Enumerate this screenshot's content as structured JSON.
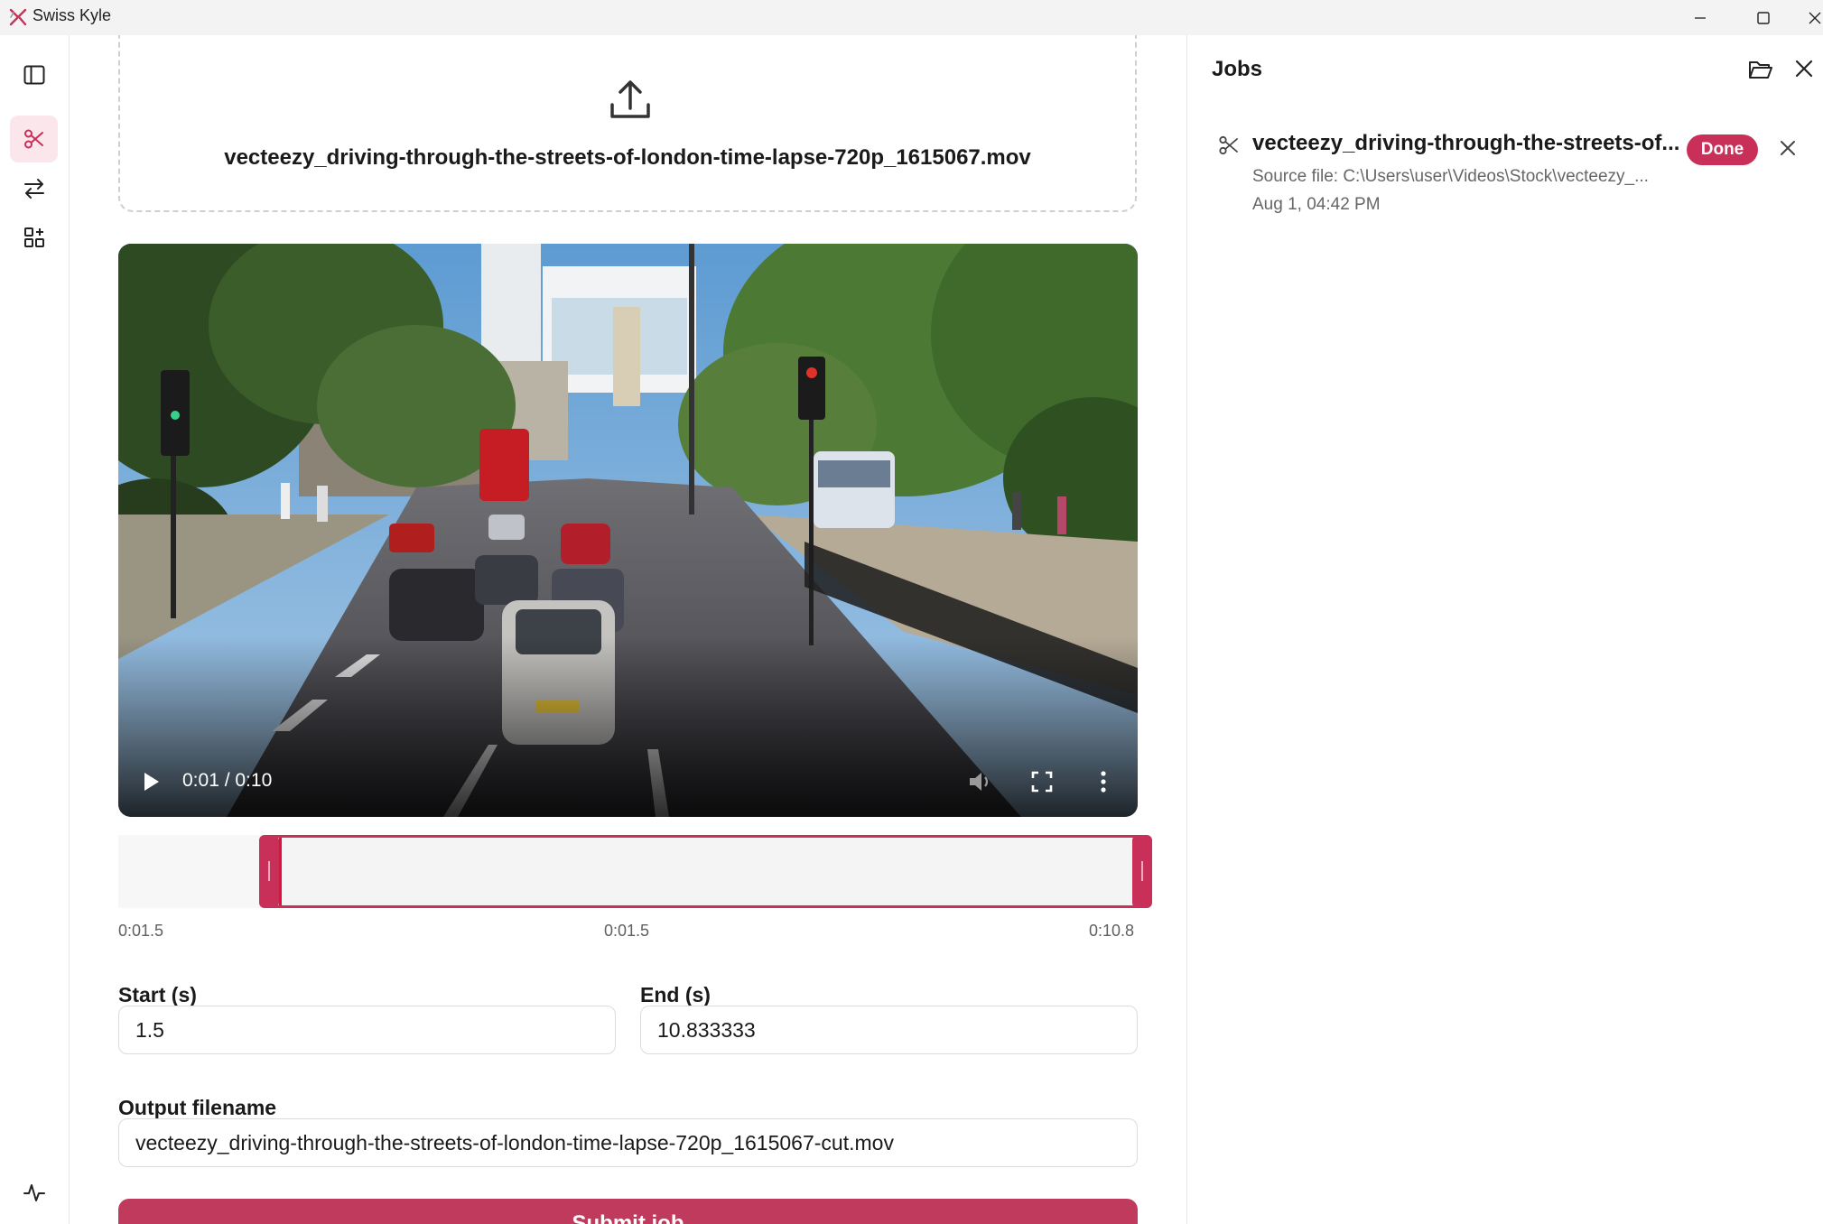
{
  "window": {
    "title": "Swiss Kyle",
    "accent_color": "#c8305a"
  },
  "sidebar": {
    "items": [
      {
        "name": "panel-toggle",
        "icon": "sidebar-toggle-icon"
      },
      {
        "name": "cut",
        "icon": "scissors-icon",
        "active": true
      },
      {
        "name": "convert",
        "icon": "arrows-exchange-icon"
      },
      {
        "name": "tools",
        "icon": "grid-plus-icon"
      },
      {
        "name": "activity",
        "icon": "activity-pulse-icon"
      }
    ]
  },
  "dropzone": {
    "file_name": "vecteezy_driving-through-the-streets-of-london-time-lapse-720p_1615067.mov"
  },
  "player": {
    "time": "0:01 / 0:10",
    "played_fraction": 0.138,
    "buffered_fraction": 0.4
  },
  "trim": {
    "start_label": "0:01.5",
    "middle_label": "0:01.5",
    "end_label": "0:10.8",
    "selection_start_fraction": 0.138,
    "selection_end_fraction": 1.0
  },
  "form": {
    "start_label": "Start (s)",
    "start_value": "1.5",
    "end_label": "End (s)",
    "end_value": "10.833333",
    "output_label": "Output filename",
    "output_value": "vecteezy_driving-through-the-streets-of-london-time-lapse-720p_1615067-cut.mov",
    "submit_label": "Submit job"
  },
  "jobs": {
    "title": "Jobs",
    "items": [
      {
        "name": "vecteezy_driving-through-the-streets-of...",
        "status": "Done",
        "source": "Source file: C:\\Users\\user\\Videos\\Stock\\vecteezy_...",
        "date": "Aug 1, 04:42 PM"
      }
    ]
  }
}
